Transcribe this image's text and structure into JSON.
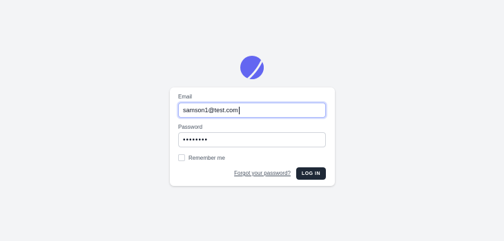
{
  "brand": {
    "logo_icon": "moon-icon",
    "accent_color": "#6366f1"
  },
  "form": {
    "email_label": "Email",
    "email_value": "samson1@test.com",
    "password_label": "Password",
    "password_value": "••••••••",
    "remember_label": "Remember me",
    "remember_checked": false,
    "forgot_link": "Forgot your password?",
    "login_button": "LOG IN"
  }
}
